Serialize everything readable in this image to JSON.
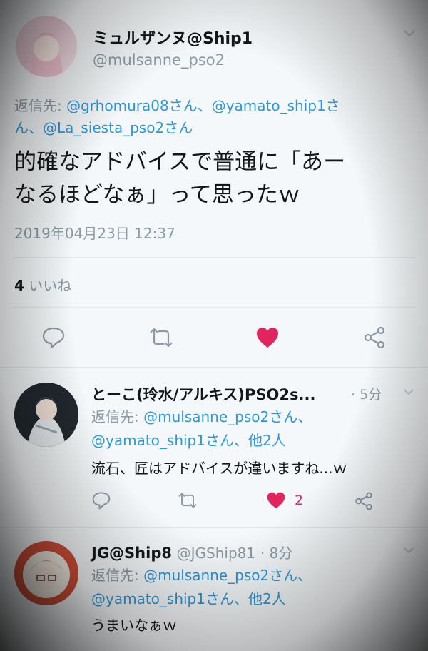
{
  "main_tweet": {
    "display_name": "ミュルザンヌ@Ship1",
    "handle": "@mulsanne_pso2",
    "reply_prefix": "返信先:",
    "reply_to": [
      "@grhomura08さん、",
      "@yamato_ship1さ",
      "ん、@La_siesta_pso2さん"
    ],
    "text_lines": [
      "的確なアドバイスで普通に「あー",
      "なるほどなぁ」って思ったｗ"
    ],
    "timestamp": "2019年04月23日 12:37",
    "likes_count": "4",
    "likes_label": "いいね",
    "liked": true
  },
  "replies": [
    {
      "display_name": "とーこ(玲水/アルキス)PSO2s...",
      "handle": "",
      "time": "· 5分",
      "reply_prefix": "返信先:",
      "reply_to_line1": "@mulsanne_pso2さん、",
      "reply_to_line2": "@yamato_ship1さん、他2人",
      "text": "流石、匠はアドバイスが違いますね...ｗ",
      "like_count": "2",
      "liked": true
    },
    {
      "display_name": "JG@Ship8",
      "handle": "@JGShip81",
      "time": "· 8分",
      "reply_prefix": "返信先:",
      "reply_to_line1": "@mulsanne_pso2さん、",
      "reply_to_line2": "@yamato_ship1さん、他2人",
      "text": "うまいなぁｗ"
    }
  ],
  "icons": [
    "reply-icon",
    "retweet-icon",
    "heart-icon",
    "share-icon",
    "chevron-down-icon"
  ],
  "colors": {
    "accent_link": "#2d97d8",
    "heart": "#e0245e",
    "muted": "#8a9aa6",
    "text": "#14171a"
  }
}
